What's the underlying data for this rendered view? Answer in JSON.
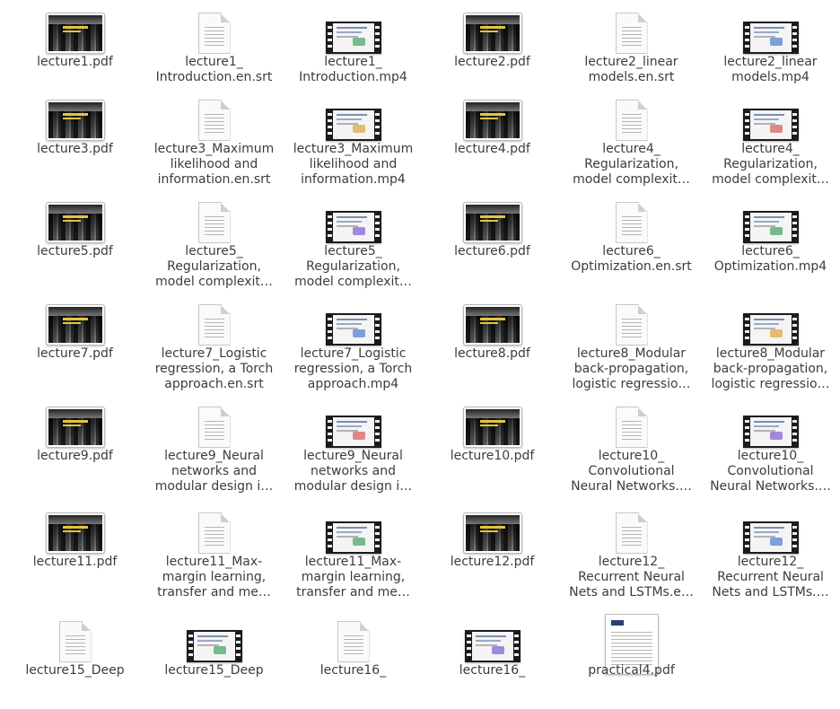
{
  "files": [
    {
      "kind": "pdf",
      "lines": [
        "lecture1.pdf"
      ]
    },
    {
      "kind": "txt",
      "lines": [
        "lecture1_",
        "Introduction.en.srt"
      ]
    },
    {
      "kind": "vid",
      "lines": [
        "lecture1_",
        "Introduction.mp4"
      ]
    },
    {
      "kind": "pdf",
      "lines": [
        "lecture2.pdf"
      ]
    },
    {
      "kind": "txt",
      "lines": [
        "lecture2_linear",
        "models.en.srt"
      ]
    },
    {
      "kind": "vid",
      "lines": [
        "lecture2_linear",
        "models.mp4"
      ]
    },
    {
      "kind": "pdf",
      "lines": [
        "lecture3.pdf"
      ]
    },
    {
      "kind": "txt",
      "lines": [
        "lecture3_Maximum",
        "likelihood and",
        "information.en.srt"
      ]
    },
    {
      "kind": "vid",
      "lines": [
        "lecture3_Maximum",
        "likelihood and",
        "information.mp4"
      ]
    },
    {
      "kind": "pdf",
      "lines": [
        "lecture4.pdf"
      ]
    },
    {
      "kind": "txt",
      "lines": [
        "lecture4_",
        "Regularization,",
        "model complexit…"
      ]
    },
    {
      "kind": "vid",
      "lines": [
        "lecture4_",
        "Regularization,",
        "model complexit…"
      ]
    },
    {
      "kind": "pdf",
      "lines": [
        "lecture5.pdf"
      ]
    },
    {
      "kind": "txt",
      "lines": [
        "lecture5_",
        "Regularization,",
        "model complexit…"
      ]
    },
    {
      "kind": "vid",
      "lines": [
        "lecture5_",
        "Regularization,",
        "model complexit…"
      ]
    },
    {
      "kind": "pdf",
      "lines": [
        "lecture6.pdf"
      ]
    },
    {
      "kind": "txt",
      "lines": [
        "lecture6_",
        "Optimization.en.srt"
      ]
    },
    {
      "kind": "vid",
      "lines": [
        "lecture6_",
        "Optimization.mp4"
      ]
    },
    {
      "kind": "pdf",
      "lines": [
        "lecture7.pdf"
      ]
    },
    {
      "kind": "txt",
      "lines": [
        "lecture7_Logistic",
        "regression, a Torch",
        "approach.en.srt"
      ]
    },
    {
      "kind": "vid",
      "lines": [
        "lecture7_Logistic",
        "regression, a Torch",
        "approach.mp4"
      ]
    },
    {
      "kind": "pdf",
      "lines": [
        "lecture8.pdf"
      ]
    },
    {
      "kind": "txt",
      "lines": [
        "lecture8_Modular",
        "back-propagation,",
        "logistic regressio…"
      ]
    },
    {
      "kind": "vid",
      "lines": [
        "lecture8_Modular",
        "back-propagation,",
        "logistic regressio…"
      ]
    },
    {
      "kind": "pdf",
      "lines": [
        "lecture9.pdf"
      ]
    },
    {
      "kind": "txt",
      "lines": [
        "lecture9_Neural",
        "networks and",
        "modular design i…"
      ]
    },
    {
      "kind": "vid",
      "lines": [
        "lecture9_Neural",
        "networks and",
        "modular design i…"
      ]
    },
    {
      "kind": "pdf",
      "lines": [
        "lecture10.pdf"
      ]
    },
    {
      "kind": "txt",
      "lines": [
        "lecture10_",
        "Convolutional",
        "Neural Networks.…"
      ]
    },
    {
      "kind": "vid",
      "lines": [
        "lecture10_",
        "Convolutional",
        "Neural Networks.…"
      ]
    },
    {
      "kind": "pdf",
      "lines": [
        "lecture11.pdf"
      ]
    },
    {
      "kind": "txt",
      "lines": [
        "lecture11_Max-",
        "margin learning,",
        "transfer and me…"
      ]
    },
    {
      "kind": "vid",
      "lines": [
        "lecture11_Max-",
        "margin learning,",
        "transfer and me…"
      ]
    },
    {
      "kind": "pdf",
      "lines": [
        "lecture12.pdf"
      ]
    },
    {
      "kind": "txt",
      "lines": [
        "lecture12_",
        "Recurrent Neural",
        "Nets and LSTMs.e…"
      ]
    },
    {
      "kind": "vid",
      "lines": [
        "lecture12_",
        "Recurrent Neural",
        "Nets and LSTMs.…"
      ]
    },
    {
      "kind": "txt",
      "lines": [
        "lecture15_Deep"
      ]
    },
    {
      "kind": "vid",
      "lines": [
        "lecture15_Deep"
      ]
    },
    {
      "kind": "txt",
      "lines": [
        "lecture16_"
      ]
    },
    {
      "kind": "vid",
      "lines": [
        "lecture16_"
      ]
    },
    {
      "kind": "doc",
      "lines": [
        "practical4.pdf"
      ]
    }
  ],
  "icons": {
    "pdf": "pdf-thumbnail-icon",
    "txt": "text-file-icon",
    "vid": "video-file-icon",
    "doc": "document-thumbnail-icon"
  },
  "colors": {
    "label": "#3c3c3c",
    "title_accent": "#e0c640"
  }
}
